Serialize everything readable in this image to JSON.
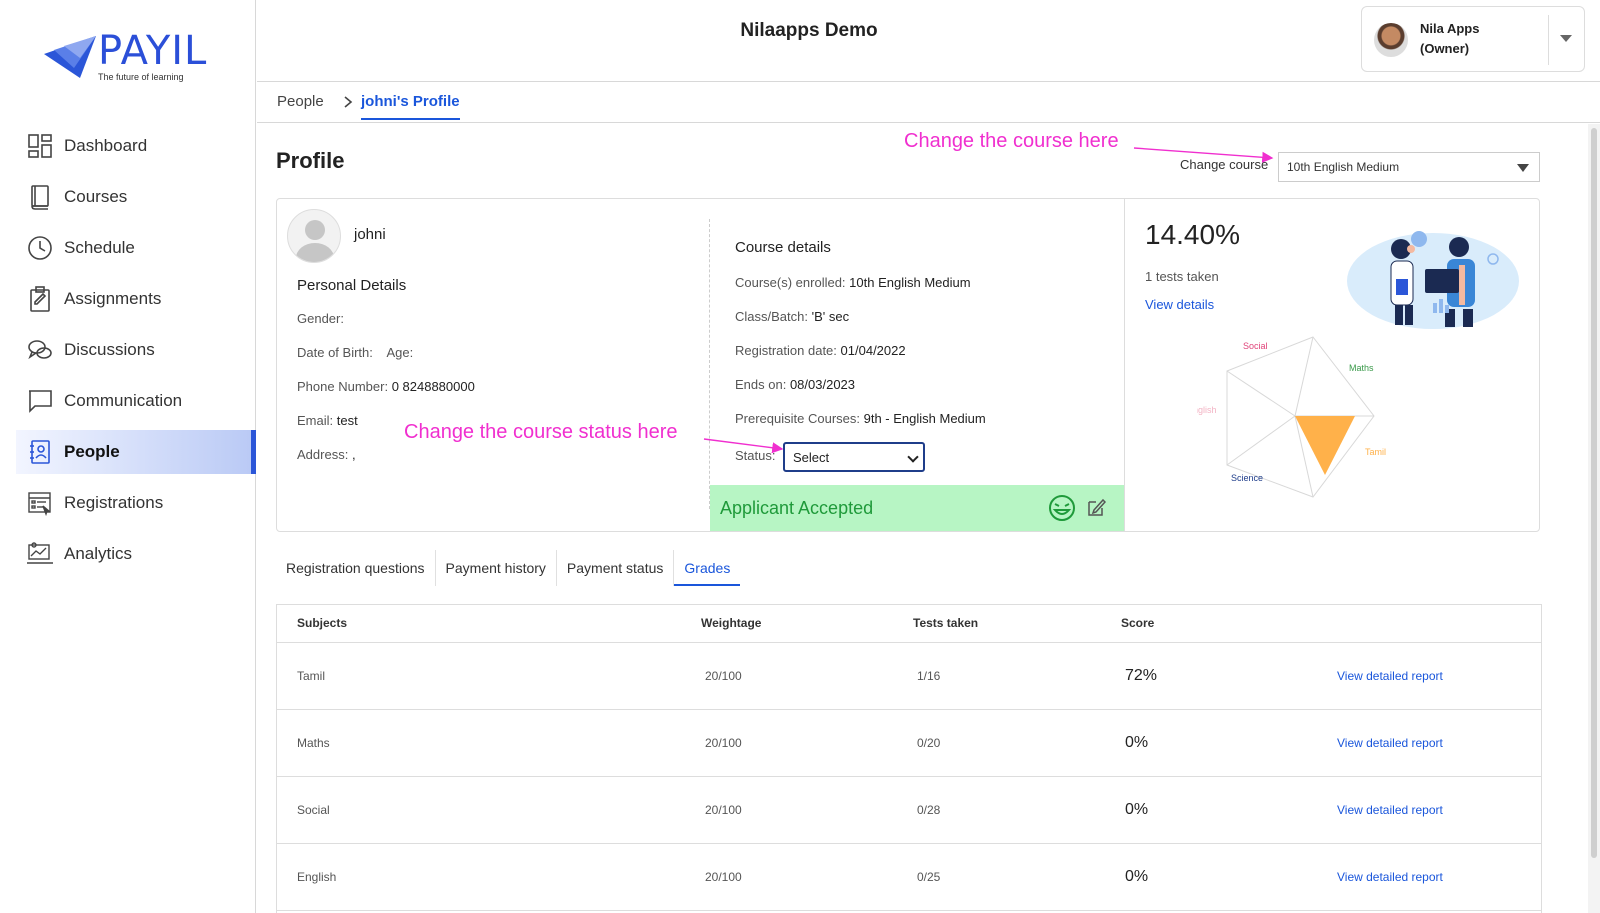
{
  "app": {
    "title": "Nilaapps Demo"
  },
  "brand": {
    "name": "PAYIL",
    "tagline": "The future of learning",
    "color": "#2b4fd8"
  },
  "user": {
    "name": "Nila Apps",
    "role": "(Owner)"
  },
  "sidebar": {
    "items": [
      {
        "label": "Dashboard",
        "icon": "dashboard-icon"
      },
      {
        "label": "Courses",
        "icon": "book-icon"
      },
      {
        "label": "Schedule",
        "icon": "clock-icon"
      },
      {
        "label": "Assignments",
        "icon": "clipboard-icon"
      },
      {
        "label": "Discussions",
        "icon": "chat-bubbles-icon"
      },
      {
        "label": "Communication",
        "icon": "message-icon"
      },
      {
        "label": "People",
        "icon": "contact-book-icon",
        "active": true
      },
      {
        "label": "Registrations",
        "icon": "form-icon"
      },
      {
        "label": "Analytics",
        "icon": "analytics-icon"
      }
    ]
  },
  "breadcrumb": {
    "parent": "People",
    "current": "johni's Profile"
  },
  "page": {
    "title": "Profile"
  },
  "annotations": {
    "course": "Change the course here",
    "status": "Change the course status here",
    "color": "#f02fcf"
  },
  "course_selector": {
    "label": "Change course",
    "value": "10th English Medium"
  },
  "profile": {
    "name": "johni",
    "personal_title": "Personal Details",
    "gender_label": "Gender:",
    "dob_label": "Date of Birth:",
    "age_label": "Age:",
    "phone_label": "Phone Number:",
    "phone_value": "0 8248880000",
    "email_label": "Email:",
    "email_value": "test",
    "address_label": "Address:",
    "address_value": ","
  },
  "course_details": {
    "title": "Course details",
    "enrolled_label": "Course(s) enrolled:",
    "enrolled_value": "10th English Medium",
    "batch_label": "Class/Batch:",
    "batch_value": "'B' sec",
    "reg_label": "Registration date:",
    "reg_value": "01/04/2022",
    "ends_label": "Ends on:",
    "ends_value": "08/03/2023",
    "prereq_label": "Prerequisite Courses:",
    "prereq_value": "9th - English Medium",
    "status_label": "Status:",
    "status_value": "Select",
    "banner": "Applicant Accepted",
    "banner_color": "#b7f5c4"
  },
  "performance": {
    "percent": "14.40%",
    "tests_taken": "1 tests taken",
    "view_details": "View details",
    "radar_labels": [
      "Social",
      "Maths",
      "English",
      "Tamil",
      "Science"
    ],
    "radar_values": {
      "Tamil": 0.72,
      "Maths": 0.0,
      "Social": 0.0,
      "English": 0.0,
      "Science": 0.0
    },
    "radar_fill": "#ffb14a"
  },
  "tabs": [
    {
      "label": "Registration questions"
    },
    {
      "label": "Payment history"
    },
    {
      "label": "Payment status"
    },
    {
      "label": "Grades",
      "active": true
    }
  ],
  "grades": {
    "headers": [
      "Subjects",
      "Weightage",
      "Tests taken",
      "Score"
    ],
    "rows": [
      {
        "subject": "Tamil",
        "weightage": "20/100",
        "tests": "1/16",
        "score": "72%",
        "link": "View detailed report"
      },
      {
        "subject": "Maths",
        "weightage": "20/100",
        "tests": "0/20",
        "score": "0%",
        "link": "View detailed report"
      },
      {
        "subject": "Social",
        "weightage": "20/100",
        "tests": "0/28",
        "score": "0%",
        "link": "View detailed report"
      },
      {
        "subject": "English",
        "weightage": "20/100",
        "tests": "0/25",
        "score": "0%",
        "link": "View detailed report"
      }
    ]
  }
}
